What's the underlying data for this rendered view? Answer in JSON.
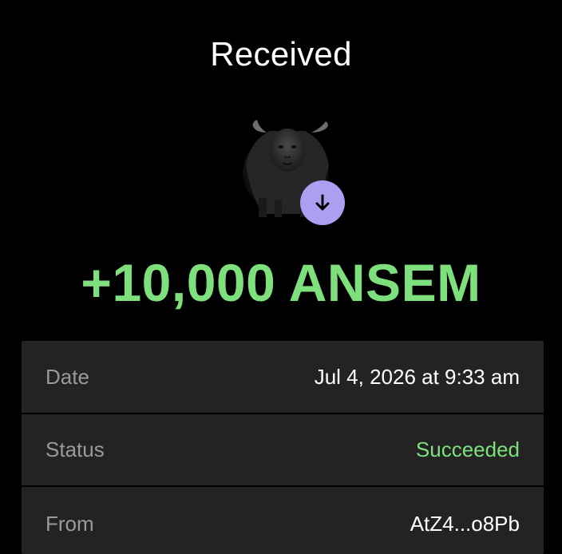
{
  "header": {
    "title": "Received"
  },
  "token": {
    "image_icon": "bull-avatar-icon",
    "badge_icon": "arrow-down-icon",
    "badge_color": "#ab9ff2"
  },
  "amount": {
    "text": "+10,000 ANSEM",
    "color": "#7ee07c"
  },
  "details": {
    "rows": [
      {
        "label": "Date",
        "value": "Jul 4, 2026 at 9:33 am"
      },
      {
        "label": "Status",
        "value": "Succeeded",
        "value_color": "#7ee07c"
      },
      {
        "label": "From",
        "value": "AtZ4...o8Pb"
      }
    ]
  }
}
